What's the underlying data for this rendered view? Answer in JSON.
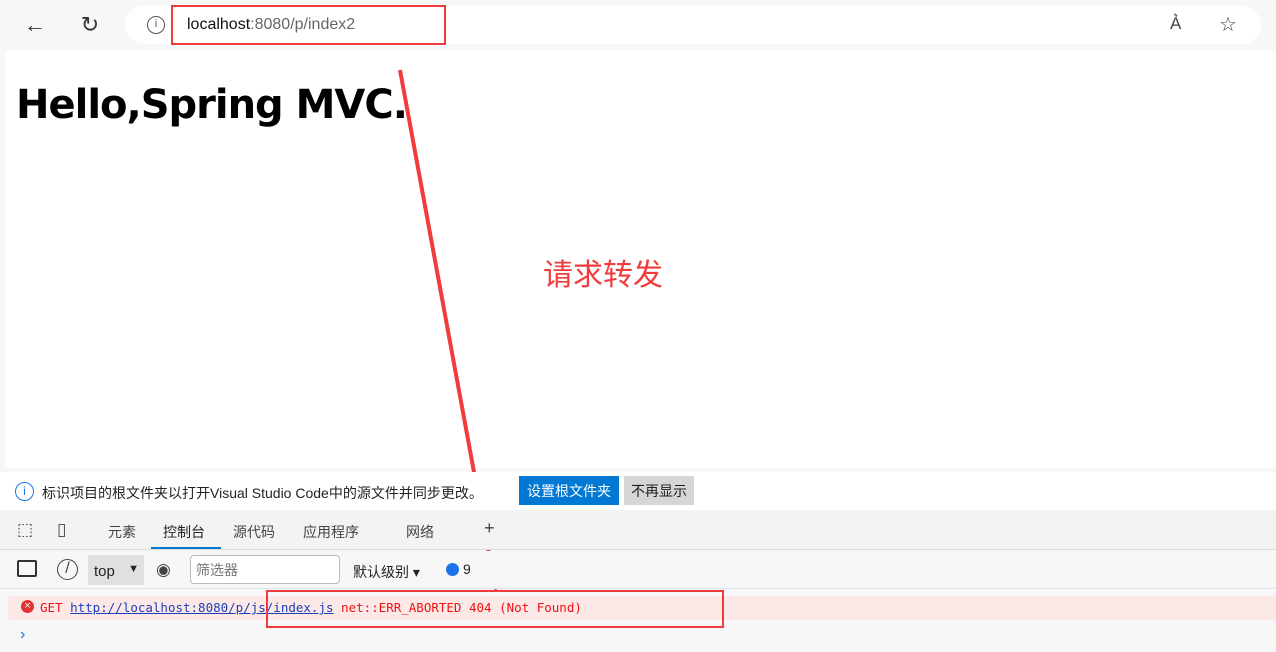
{
  "browser": {
    "url_host": "localhost",
    "url_path": ":8080/p/index2",
    "info_icon": "info-icon"
  },
  "page": {
    "heading": "Hello,Spring MVC."
  },
  "annotation": {
    "text": "请求转发",
    "color": "#f03c3c"
  },
  "infobar": {
    "message": "标识项目的根文件夹以打开Visual Studio Code中的源文件并同步更改。",
    "primary_button": "设置根文件夹",
    "secondary_button": "不再显示"
  },
  "devtools": {
    "tabs": [
      {
        "label": "元素"
      },
      {
        "label": "控制台",
        "active": true
      },
      {
        "label": "源代码"
      },
      {
        "label": "应用程序"
      },
      {
        "label": "网络"
      }
    ],
    "add_tab": "+"
  },
  "console": {
    "context": "top",
    "filter_placeholder": "筛选器",
    "level": "默认级别",
    "message_count": "9",
    "error": {
      "method": "GET",
      "url": "http://localhost:8080/p/js/index.js",
      "message": "net::ERR_ABORTED 404 (Not Found)"
    },
    "prompt": "›"
  },
  "colors": {
    "accent": "#0078d4",
    "error": "#ee1111",
    "error_bg": "#fde8e8"
  }
}
